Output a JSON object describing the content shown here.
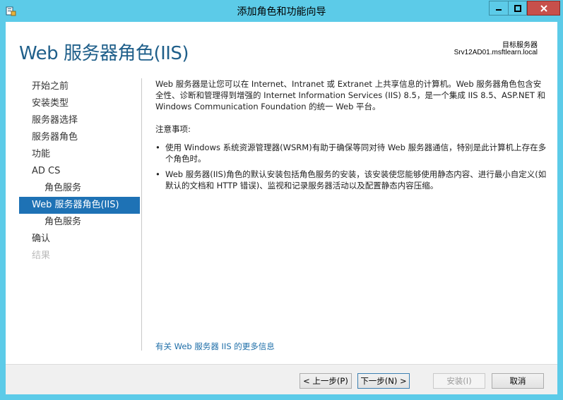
{
  "window": {
    "title": "添加角色和功能向导",
    "icon": "server-manager-icon"
  },
  "header": {
    "page_title": "Web 服务器角色(IIS)",
    "target_label": "目标服务器",
    "target_value": "Srv12AD01.msftlearn.local"
  },
  "nav": {
    "items": [
      {
        "label": "开始之前",
        "state": "normal"
      },
      {
        "label": "安装类型",
        "state": "normal"
      },
      {
        "label": "服务器选择",
        "state": "normal"
      },
      {
        "label": "服务器角色",
        "state": "normal"
      },
      {
        "label": "功能",
        "state": "normal"
      },
      {
        "label": "AD CS",
        "state": "normal"
      },
      {
        "label": "角色服务",
        "state": "sub"
      },
      {
        "label": "Web 服务器角色(IIS)",
        "state": "active"
      },
      {
        "label": "角色服务",
        "state": "sub"
      },
      {
        "label": "确认",
        "state": "normal"
      },
      {
        "label": "结果",
        "state": "disabled"
      }
    ]
  },
  "content": {
    "intro": "Web 服务器是让您可以在 Internet、Intranet 或 Extranet 上共享信息的计算机。Web 服务器角色包含安全性、诊断和管理得到增强的 Internet Information Services (IIS) 8.5，是一个集成 IIS 8.5、ASP.NET 和 Windows Communication Foundation 的统一 Web 平台。",
    "notes_title": "注意事项:",
    "notes": [
      "使用 Windows 系统资源管理器(WSRM)有助于确保等同对待 Web 服务器通信，特别是此计算机上存在多个角色时。",
      "Web 服务器(IIS)角色的默认安装包括角色服务的安装，该安装使您能够使用静态内容、进行最小自定义(如默认的文档和 HTTP 错误)、监视和记录服务器活动以及配置静态内容压缩。"
    ],
    "bullet": "•",
    "more_link": "有关 Web 服务器 IIS 的更多信息"
  },
  "footer": {
    "prev_label": "< 上一步(P)",
    "next_label": "下一步(N) >",
    "install_label": "安装(I)",
    "cancel_label": "取消"
  },
  "colors": {
    "titlebar": "#5ccbe8",
    "accent": "#1e72b5",
    "title_text": "#1f5f8a",
    "close_button": "#c7504b"
  }
}
